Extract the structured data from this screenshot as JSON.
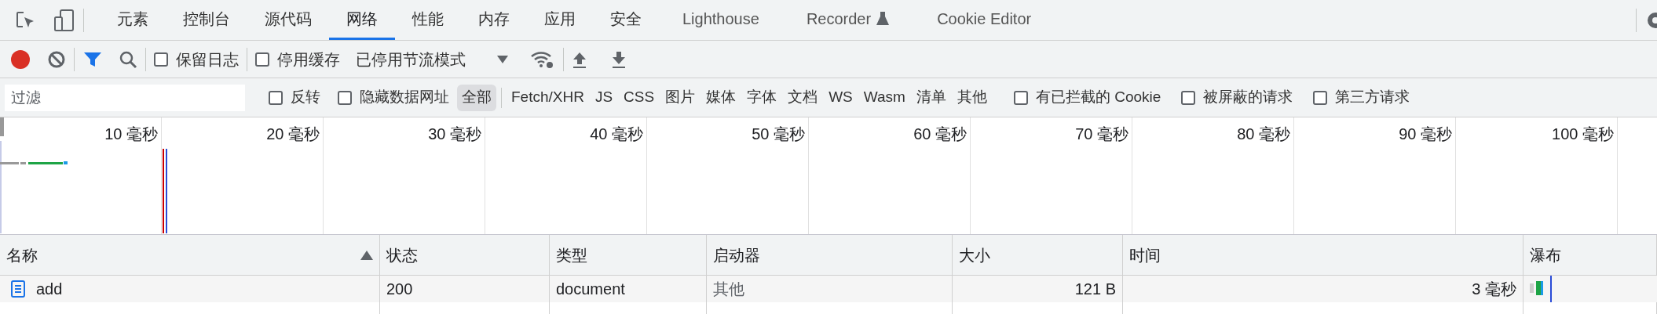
{
  "panel_tabs": [
    {
      "label": "元素",
      "selected": false
    },
    {
      "label": "控制台",
      "selected": false
    },
    {
      "label": "源代码",
      "selected": false
    },
    {
      "label": "网络",
      "selected": true
    },
    {
      "label": "性能",
      "selected": false
    },
    {
      "label": "内存",
      "selected": false
    },
    {
      "label": "应用",
      "selected": false
    },
    {
      "label": "安全",
      "selected": false
    },
    {
      "label": "Lighthouse",
      "selected": false
    },
    {
      "label": "Recorder",
      "selected": false,
      "experimental": true
    },
    {
      "label": "Cookie Editor",
      "selected": false
    }
  ],
  "toolbar": {
    "recording": true,
    "filter_active": true,
    "preserve_log": {
      "label": "保留日志",
      "checked": false
    },
    "disable_cache": {
      "label": "停用缓存",
      "checked": false
    },
    "throttling": "已停用节流模式"
  },
  "filter_bar": {
    "placeholder": "过滤",
    "invert": {
      "label": "反转",
      "checked": false
    },
    "hide_data_urls": {
      "label": "隐藏数据网址",
      "checked": false
    },
    "types": [
      {
        "label": "全部",
        "selected": true
      },
      {
        "label": "Fetch/XHR",
        "selected": false
      },
      {
        "label": "JS",
        "selected": false
      },
      {
        "label": "CSS",
        "selected": false
      },
      {
        "label": "图片",
        "selected": false
      },
      {
        "label": "媒体",
        "selected": false
      },
      {
        "label": "字体",
        "selected": false
      },
      {
        "label": "文档",
        "selected": false
      },
      {
        "label": "WS",
        "selected": false
      },
      {
        "label": "Wasm",
        "selected": false
      },
      {
        "label": "清单",
        "selected": false
      },
      {
        "label": "其他",
        "selected": false
      }
    ],
    "options": [
      {
        "label": "有已拦截的 Cookie",
        "checked": false
      },
      {
        "label": "被屏蔽的请求",
        "checked": false
      },
      {
        "label": "第三方请求",
        "checked": false
      }
    ]
  },
  "overview": {
    "ticks": [
      "10 毫秒",
      "20 毫秒",
      "30 毫秒",
      "40 毫秒",
      "50 毫秒",
      "60 毫秒",
      "70 毫秒",
      "80 毫秒",
      "90 毫秒",
      "100 毫秒"
    ]
  },
  "table": {
    "columns": [
      {
        "label": "名称",
        "sorted": true
      },
      {
        "label": "状态",
        "sorted": false
      },
      {
        "label": "类型",
        "sorted": false
      },
      {
        "label": "启动器",
        "sorted": false
      },
      {
        "label": "大小",
        "sorted": false
      },
      {
        "label": "时间",
        "sorted": false
      },
      {
        "label": "瀑布",
        "sorted": false
      }
    ],
    "rows": [
      {
        "name": "add",
        "status": "200",
        "type": "document",
        "initiator": "其他",
        "size": "121 B",
        "time": "3 毫秒"
      }
    ]
  }
}
